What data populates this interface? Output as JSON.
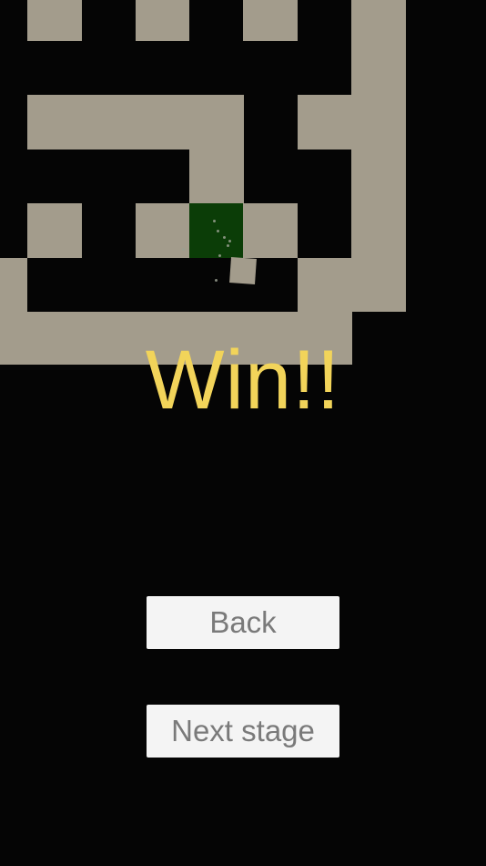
{
  "game": {
    "status_text": "Win!!",
    "buttons": {
      "back_label": "Back",
      "next_stage_label": "Next stage"
    },
    "colors": {
      "background": "#050505",
      "wall": "#a39c8c",
      "goal": "#0b3d07",
      "win_text": "#f2d45a",
      "button_bg": "#f4f4f4",
      "button_text": "#7a7a7a"
    }
  }
}
